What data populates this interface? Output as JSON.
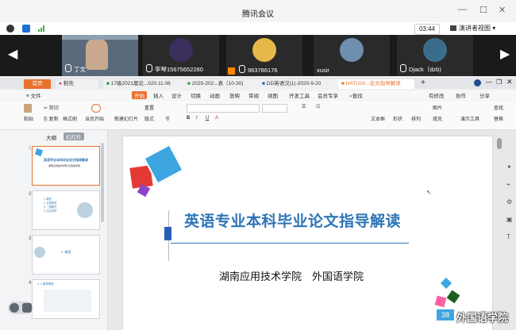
{
  "meeting": {
    "title": "腾讯会议",
    "timer": "03:44",
    "view_label": "演讲者视图"
  },
  "participants": [
    {
      "name": "丁文"
    },
    {
      "name": "李琴15675652280"
    },
    {
      "name": "963786176"
    },
    {
      "name": "xusir"
    },
    {
      "name": "Djack（dzb)"
    }
  ],
  "tabs": [
    {
      "label": "首页"
    },
    {
      "label": "稻壳"
    },
    {
      "label": "17级2021届论...020.11.06"
    },
    {
      "label": "2020-202...表（10-30)"
    },
    {
      "label": "DD英语汉(1)-2020-9-20"
    },
    {
      "label": "HATU20...论文指导解读"
    }
  ],
  "menu": {
    "file": "文件",
    "items": [
      "开始",
      "插入",
      "设计",
      "切换",
      "动画",
      "放映",
      "审阅",
      "视图",
      "开发工具",
      "会员专享"
    ],
    "search": "查找",
    "right": [
      "有修改",
      "协作",
      "分享"
    ]
  },
  "ribbon": {
    "paste": "粘贴",
    "cut": "剪切",
    "copy": "复制",
    "format_painter": "格式刷",
    "current_start": "当页开始",
    "new_slide": "新建幻灯片",
    "layout": "版式",
    "section": "节",
    "reset": "重置",
    "textbox": "文本框",
    "shape": "形状",
    "arrange": "排列",
    "picture": "图片",
    "fill": "填充",
    "find": "查找",
    "replace": "替换",
    "presenter": "演示工具"
  },
  "panel": {
    "outline": "大纲",
    "slides": "幻灯片"
  },
  "thumbs": [
    {
      "num": "1",
      "title": "英语专业本科毕业论文指导解读",
      "sub": "湖南应用技术学院 外国语学院"
    },
    {
      "num": "2",
      "lines": [
        "1. 概述",
        "2. 文档规范",
        "3. 一般稿式",
        "4. 注意事项"
      ]
    },
    {
      "num": "3",
      "title": "1. 概述"
    },
    {
      "num": "4",
      "title": "1. 1 指导原则"
    }
  ],
  "slide": {
    "title": "英语专业本科毕业论文指导解读",
    "subtitle": "湖南应用技术学院　外国语学院"
  },
  "watermark": "外国语学院",
  "watermark_num": "38",
  "colors": {
    "accent_blue": "#2e75b6",
    "wps_orange": "#e8712b",
    "tab_red": "#d9363e"
  }
}
